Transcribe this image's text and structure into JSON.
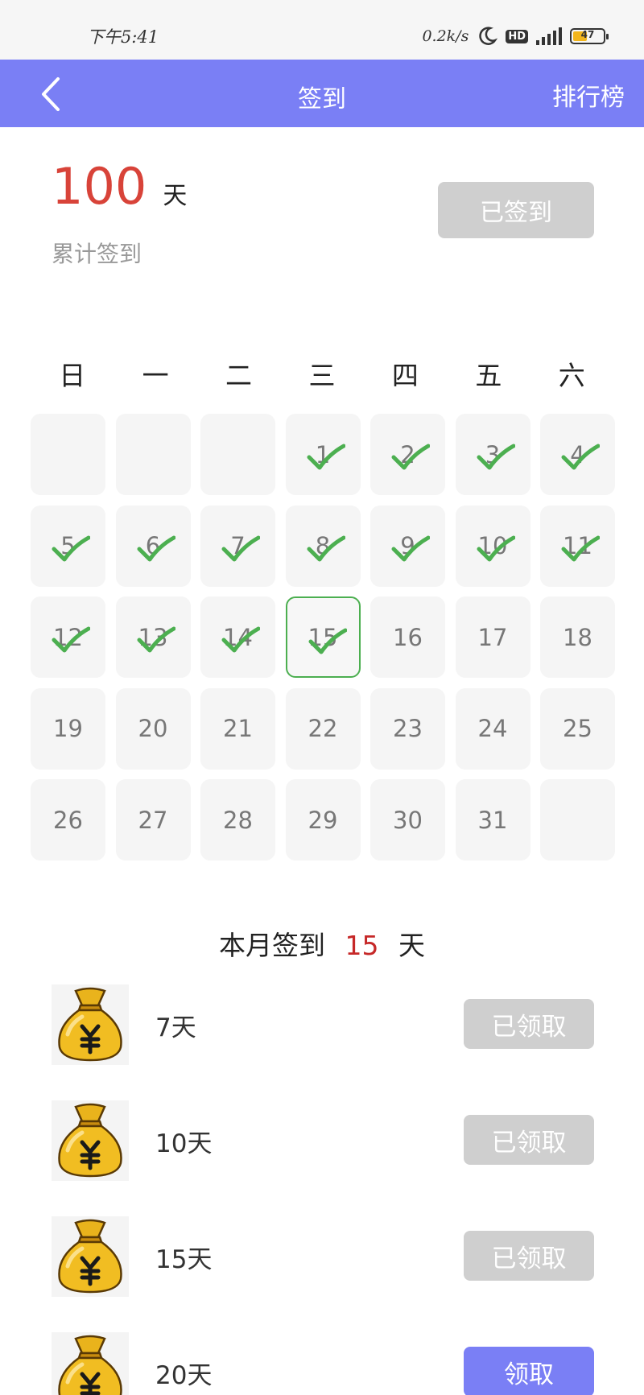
{
  "status_bar": {
    "time": "下午5:41",
    "speed": "0.2k/s",
    "hd": "HD",
    "battery": "47",
    "battery_level": 0.47
  },
  "header": {
    "title": "签到",
    "rank_label": "排行榜"
  },
  "summary": {
    "total_days": "100",
    "unit": "天",
    "label": "累计签到",
    "signed_button": "已签到"
  },
  "calendar": {
    "weekdays": [
      "日",
      "一",
      "二",
      "三",
      "四",
      "五",
      "六"
    ],
    "days": [
      "",
      "",
      "",
      "1",
      "2",
      "3",
      "4",
      "5",
      "6",
      "7",
      "8",
      "9",
      "10",
      "11",
      "12",
      "13",
      "14",
      "15",
      "16",
      "17",
      "18",
      "19",
      "20",
      "21",
      "22",
      "23",
      "24",
      "25",
      "26",
      "27",
      "28",
      "29",
      "30",
      "31",
      ""
    ],
    "checked_through": 15,
    "today": "15"
  },
  "month_summary": {
    "prefix": "本月签到",
    "count": "15",
    "suffix": "天"
  },
  "rewards": [
    {
      "label": "7天",
      "button": "已领取",
      "claimed": true
    },
    {
      "label": "10天",
      "button": "已领取",
      "claimed": true
    },
    {
      "label": "15天",
      "button": "已领取",
      "claimed": true
    },
    {
      "label": "20天",
      "button": "领取",
      "claimed": false
    }
  ],
  "colors": {
    "accent": "#7a7ff5",
    "highlight": "#d84339",
    "check": "#4caf50",
    "disabled": "#cfcfcf"
  }
}
